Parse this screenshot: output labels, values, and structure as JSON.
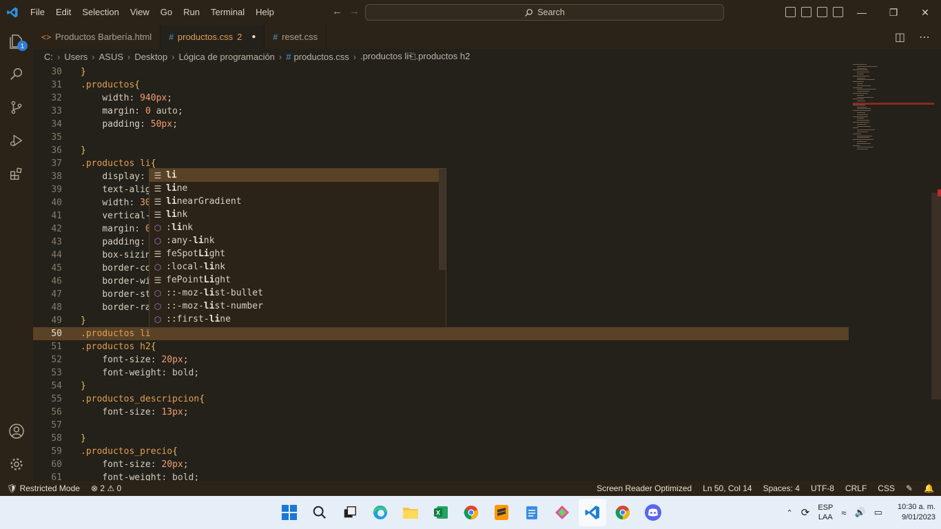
{
  "titlebar": {
    "menu": [
      "File",
      "Edit",
      "Selection",
      "View",
      "Go",
      "Run",
      "Terminal",
      "Help"
    ],
    "search_label": "Search"
  },
  "activity": {
    "explorer_badge": "1"
  },
  "tabs": [
    {
      "icon": "<>",
      "label": "Productos Barbería.html"
    },
    {
      "icon": "#",
      "label": "productos.css",
      "count": "2"
    },
    {
      "icon": "#",
      "label": "reset.css"
    }
  ],
  "breadcrumb": [
    "C:",
    "Users",
    "ASUS",
    "Desktop",
    "Lógica de programación",
    "productos.css",
    ".productos li⎗.productos h2"
  ],
  "editor": {
    "current_line": "50",
    "lines": [
      {
        "n": "30",
        "t": "}"
      },
      {
        "n": "31",
        "t": ".productos{"
      },
      {
        "n": "32",
        "t": "    width: 940px;"
      },
      {
        "n": "33",
        "t": "    margin: 0 auto;"
      },
      {
        "n": "34",
        "t": "    padding: 50px;"
      },
      {
        "n": "35",
        "t": ""
      },
      {
        "n": "36",
        "t": "}"
      },
      {
        "n": "37",
        "t": ".productos li{"
      },
      {
        "n": "38",
        "t": "    display: "
      },
      {
        "n": "39",
        "t": "    text-alig"
      },
      {
        "n": "40",
        "t": "    width: 30"
      },
      {
        "n": "41",
        "t": "    vertical-"
      },
      {
        "n": "42",
        "t": "    margin: 0"
      },
      {
        "n": "43",
        "t": "    padding: "
      },
      {
        "n": "44",
        "t": "    box-sizin"
      },
      {
        "n": "45",
        "t": "    border-co"
      },
      {
        "n": "46",
        "t": "    border-wi"
      },
      {
        "n": "47",
        "t": "    border-st"
      },
      {
        "n": "48",
        "t": "    border-ra"
      },
      {
        "n": "49",
        "t": "}"
      },
      {
        "n": "50",
        "t": ".productos li"
      },
      {
        "n": "51",
        "t": ".productos h2{"
      },
      {
        "n": "52",
        "t": "    font-size: 20px;"
      },
      {
        "n": "53",
        "t": "    font-weight: bold;"
      },
      {
        "n": "54",
        "t": "}"
      },
      {
        "n": "55",
        "t": ".productos_descripcion{"
      },
      {
        "n": "56",
        "t": "    font-size: 13px;"
      },
      {
        "n": "57",
        "t": ""
      },
      {
        "n": "58",
        "t": "}"
      },
      {
        "n": "59",
        "t": ".productos_precio{"
      },
      {
        "n": "60",
        "t": "    font-size: 20px;"
      },
      {
        "n": "61",
        "t": "    font-weight: bold;"
      }
    ]
  },
  "suggest": {
    "items": [
      {
        "kind": "text",
        "pre": "",
        "match": "li",
        "post": ""
      },
      {
        "kind": "text",
        "pre": "",
        "match": "li",
        "post": "ne"
      },
      {
        "kind": "text",
        "pre": "",
        "match": "li",
        "post": "nearGradient"
      },
      {
        "kind": "text",
        "pre": "",
        "match": "li",
        "post": "nk"
      },
      {
        "kind": "property",
        "pre": ":",
        "match": "li",
        "post": "nk"
      },
      {
        "kind": "property",
        "pre": ":any-",
        "match": "li",
        "post": "nk"
      },
      {
        "kind": "text",
        "pre": "feSpot",
        "match": "Li",
        "post": "ght"
      },
      {
        "kind": "property",
        "pre": ":local-",
        "match": "li",
        "post": "nk"
      },
      {
        "kind": "text",
        "pre": "fePoint",
        "match": "Li",
        "post": "ght"
      },
      {
        "kind": "property",
        "pre": "::-moz-",
        "match": "li",
        "post": "st-bullet"
      },
      {
        "kind": "property",
        "pre": "::-moz-",
        "match": "li",
        "post": "st-number"
      },
      {
        "kind": "property",
        "pre": "::first-",
        "match": "li",
        "post": "ne"
      }
    ]
  },
  "statusbar": {
    "restricted": "Restricted Mode",
    "errors": "2",
    "warnings": "0",
    "screen_reader": "Screen Reader Optimized",
    "position": "Ln 50, Col 14",
    "spaces": "Spaces: 4",
    "encoding": "UTF-8",
    "eol": "CRLF",
    "language": "CSS"
  },
  "taskbar": {
    "lang_top": "ESP",
    "lang_bottom": "LAA",
    "time": "10:30 a. m.",
    "date": "9/01/2023"
  },
  "colors": {
    "accent": "#5a4227",
    "selector": "#e0a050",
    "number": "#f0a070",
    "badge": "#2f7fd6"
  }
}
